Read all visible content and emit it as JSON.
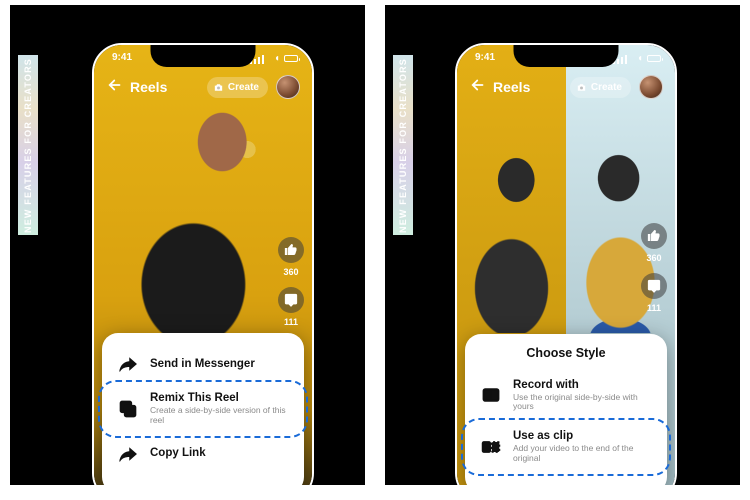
{
  "badge_text": "NEW FEATURES FOR CREATORS",
  "status": {
    "time": "9:41"
  },
  "header": {
    "title": "Reels",
    "create_label": "Create"
  },
  "rail": {
    "like_count": "360",
    "comment_count": "111"
  },
  "left_sheet": {
    "row1": {
      "title": "Send in Messenger"
    },
    "row2": {
      "title": "Remix This Reel",
      "sub": "Create a side-by-side version of this reel"
    },
    "row3": {
      "title": "Copy Link"
    }
  },
  "right_sheet": {
    "title": "Choose Style",
    "row1": {
      "title": "Record with",
      "sub": "Use the original side-by-side with yours"
    },
    "row2": {
      "title": "Use as clip",
      "sub": "Add your video to the end of the original"
    }
  }
}
